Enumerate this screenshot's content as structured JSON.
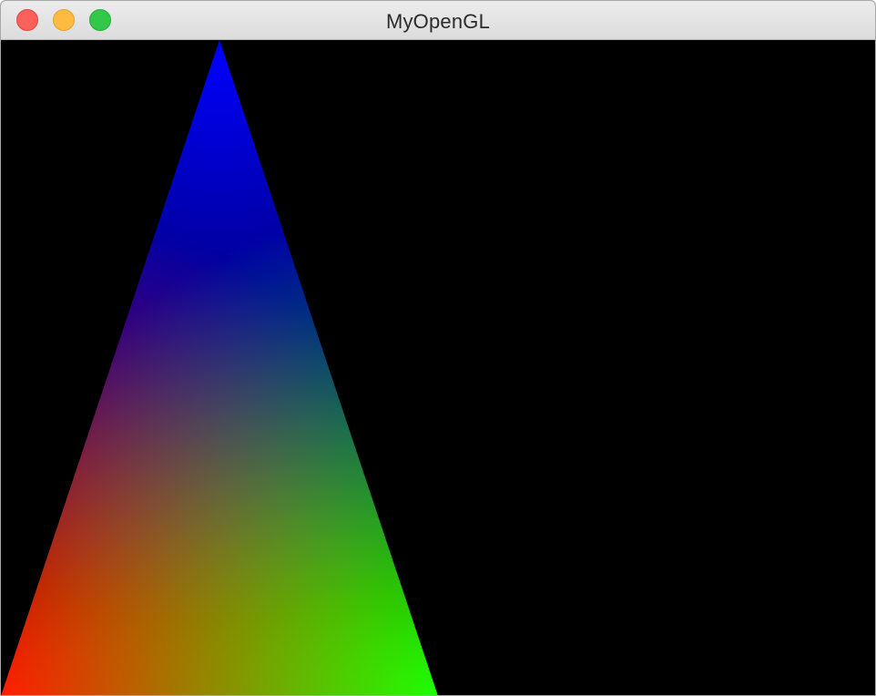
{
  "window": {
    "title": "MyOpenGL"
  },
  "controls": {
    "close": {
      "icon": "close-icon",
      "color": "#fc605b"
    },
    "minimize": {
      "icon": "minimize-icon",
      "color": "#fdbc40"
    },
    "zoom": {
      "icon": "zoom-icon",
      "color": "#34c84a"
    }
  },
  "canvas": {
    "background": "#000000",
    "triangle": {
      "vertex_colors": {
        "top": "#0000ff",
        "bottom_left": "#ff0000",
        "bottom_right": "#00ff00"
      }
    }
  }
}
